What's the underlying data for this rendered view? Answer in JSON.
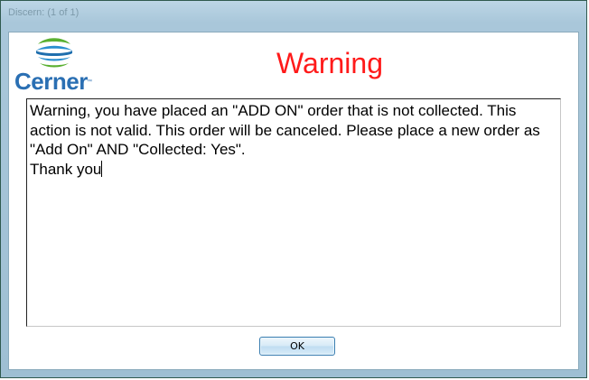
{
  "window": {
    "title": "Discern: (1 of 1)"
  },
  "logo": {
    "brand": "Cerner",
    "trademark": "™"
  },
  "dialog": {
    "heading": "Warning",
    "message": "Warning, you have placed an \"ADD ON\" order that is not collected. This action is not valid. This order will be canceled. Please place a new order as \"Add On\" AND \"Collected: Yes\".\nThank you",
    "ok_label": "OK"
  },
  "colors": {
    "heading": "#ff1a1a",
    "brand_blue": "#2a6fb3",
    "brand_green": "#5ab031"
  },
  "icons": {
    "logo_mark": "cerner-logo-icon"
  }
}
